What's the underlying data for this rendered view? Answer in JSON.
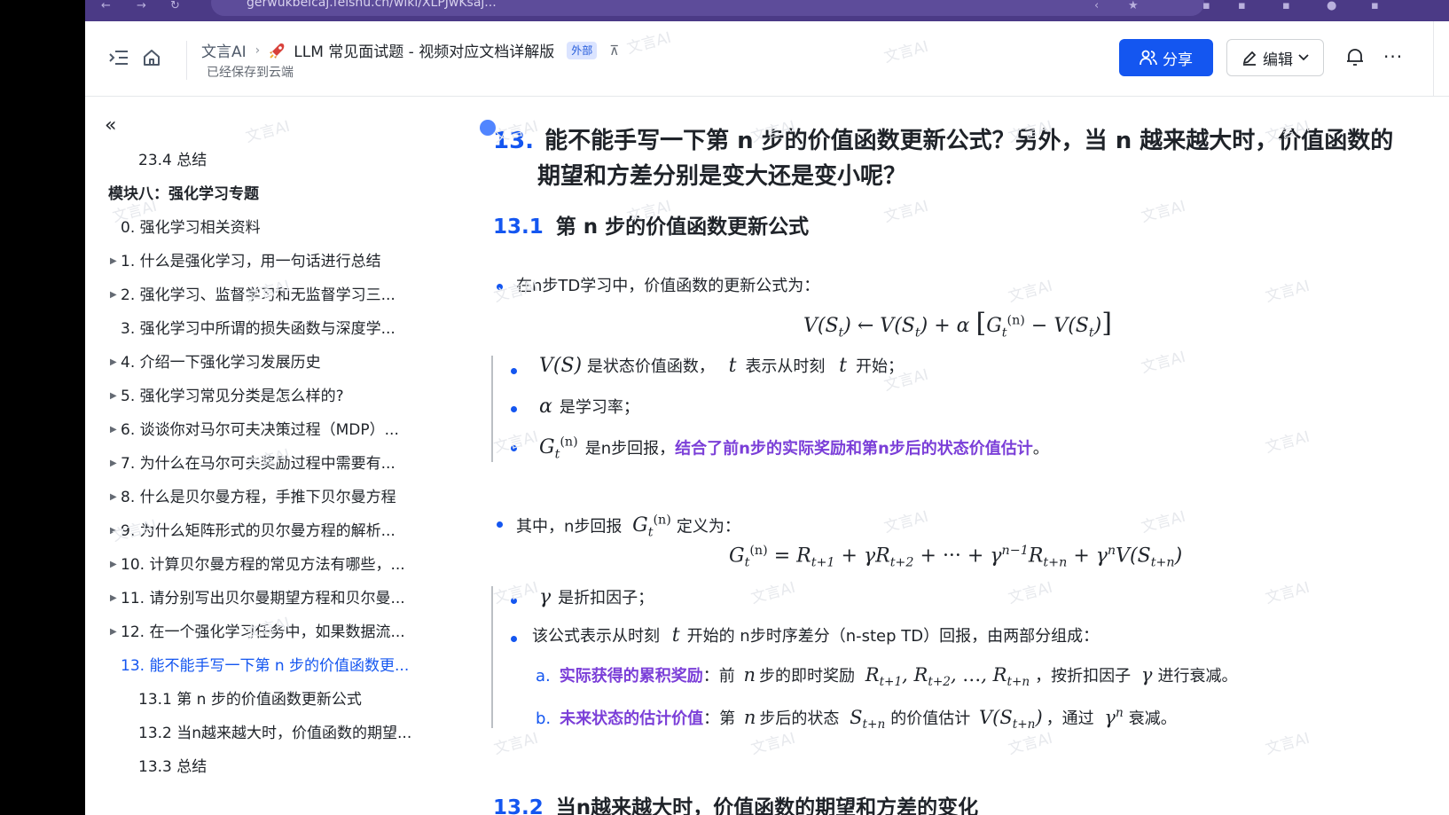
{
  "browser": {
    "url": "gerwukbeicaj.feishu.cn/wiki/XLPJwKsaj..."
  },
  "header": {
    "breadcrumb_root": "文言AI",
    "doc_title": "LLM 常见面试题 - 视频对应文档详解版",
    "badge": "外部",
    "saved_status": "已经保存到云端",
    "share_label": "分享",
    "edit_label": "编辑"
  },
  "watermark": "文言AI",
  "sidebar": {
    "items": [
      {
        "text": "23.4 总结",
        "level": 3
      },
      {
        "text": "模块八：强化学习专题",
        "level": 1
      },
      {
        "text": "0. 强化学习相关资料",
        "level": 2
      },
      {
        "text": "1. 什么是强化学习，用一句话进行总结",
        "level": 2,
        "expandable": true
      },
      {
        "text": "2. 强化学习、监督学习和无监督学习三...",
        "level": 2,
        "expandable": true
      },
      {
        "text": "3. 强化学习中所谓的损失函数与深度学...",
        "level": 2
      },
      {
        "text": "4. 介绍一下强化学习发展历史",
        "level": 2,
        "expandable": true
      },
      {
        "text": "5. 强化学习常见分类是怎么样的?",
        "level": 2,
        "expandable": true
      },
      {
        "text": "6. 谈谈你对马尔可夫决策过程（MDP）...",
        "level": 2,
        "expandable": true
      },
      {
        "text": "7. 为什么在马尔可夫奖励过程中需要有...",
        "level": 2,
        "expandable": true
      },
      {
        "text": "8. 什么是贝尔曼方程，手推下贝尔曼方程",
        "level": 2,
        "expandable": true
      },
      {
        "text": "9. 为什么矩阵形式的贝尔曼方程的解析...",
        "level": 2,
        "expandable": true
      },
      {
        "text": "10. 计算贝尔曼方程的常见方法有哪些，...",
        "level": 2,
        "expandable": true
      },
      {
        "text": "11. 请分别写出贝尔曼期望方程和贝尔曼...",
        "level": 2,
        "expandable": true
      },
      {
        "text": "12. 在一个强化学习任务中，如果数据流...",
        "level": 2,
        "expandable": true
      },
      {
        "text": "13. 能不能手写一下第 n 步的价值函数更...",
        "level": 2,
        "active": true
      },
      {
        "text": "13.1 第 n 步的价值函数更新公式",
        "level": 3
      },
      {
        "text": "13.2 当n越来越大时，价值函数的期望...",
        "level": 3
      },
      {
        "text": "13.3 总结",
        "level": 3
      }
    ]
  },
  "content": {
    "h1_num": "13.",
    "h1_line1": "能不能手写一下第 n 步的价值函数更新公式？另外，当 n 越来越大时，价值函数的",
    "h1_line2": "期望和方差分别是变大还是变小呢？",
    "h2_num": "13.1",
    "h2_text": "第 n 步的价值函数更新公式",
    "b1_text": "在n步TD学习中，价值函数的更新公式为：",
    "b1a_text1": "是状态价值函数，",
    "b1a_text2": "表示从时刻",
    "b1a_text3": "开始；",
    "b1b_text": "是学习率；",
    "b1c_text": "是n步回报，",
    "b1c_highlight": "结合了前n步的实际奖励和第n步后的状态价值估计",
    "b1c_end": "。",
    "b2_text1": "其中，n步回报",
    "b2_text2": "定义为：",
    "b2a_text": "是折扣因子；",
    "b2b_text1": "该公式表示从时刻",
    "b2b_text2": "开始的 n步时序差分（n-step TD）回报，由两部分组成：",
    "a_label": "a.",
    "a_highlight": "实际获得的累积奖励",
    "a_text1": "：前",
    "a_text2": "步的即时奖励",
    "a_text3": "，按折扣因子",
    "a_text4": "进行衰减。",
    "b_label": "b.",
    "b_highlight": "未来状态的估计价值",
    "b_text1": "：第",
    "b_text2": "步后的状态",
    "b_text3": "的价值估计",
    "b_text4": "，通过",
    "b_text5": "衰减。",
    "h2b_num": "13.2",
    "h2b_text": "当n越来越大时，价值函数的期望和方差的变化"
  },
  "colors": {
    "accent": "#1456f0",
    "highlight": "#7b3fd8",
    "browser_bar": "#4b3a86"
  }
}
